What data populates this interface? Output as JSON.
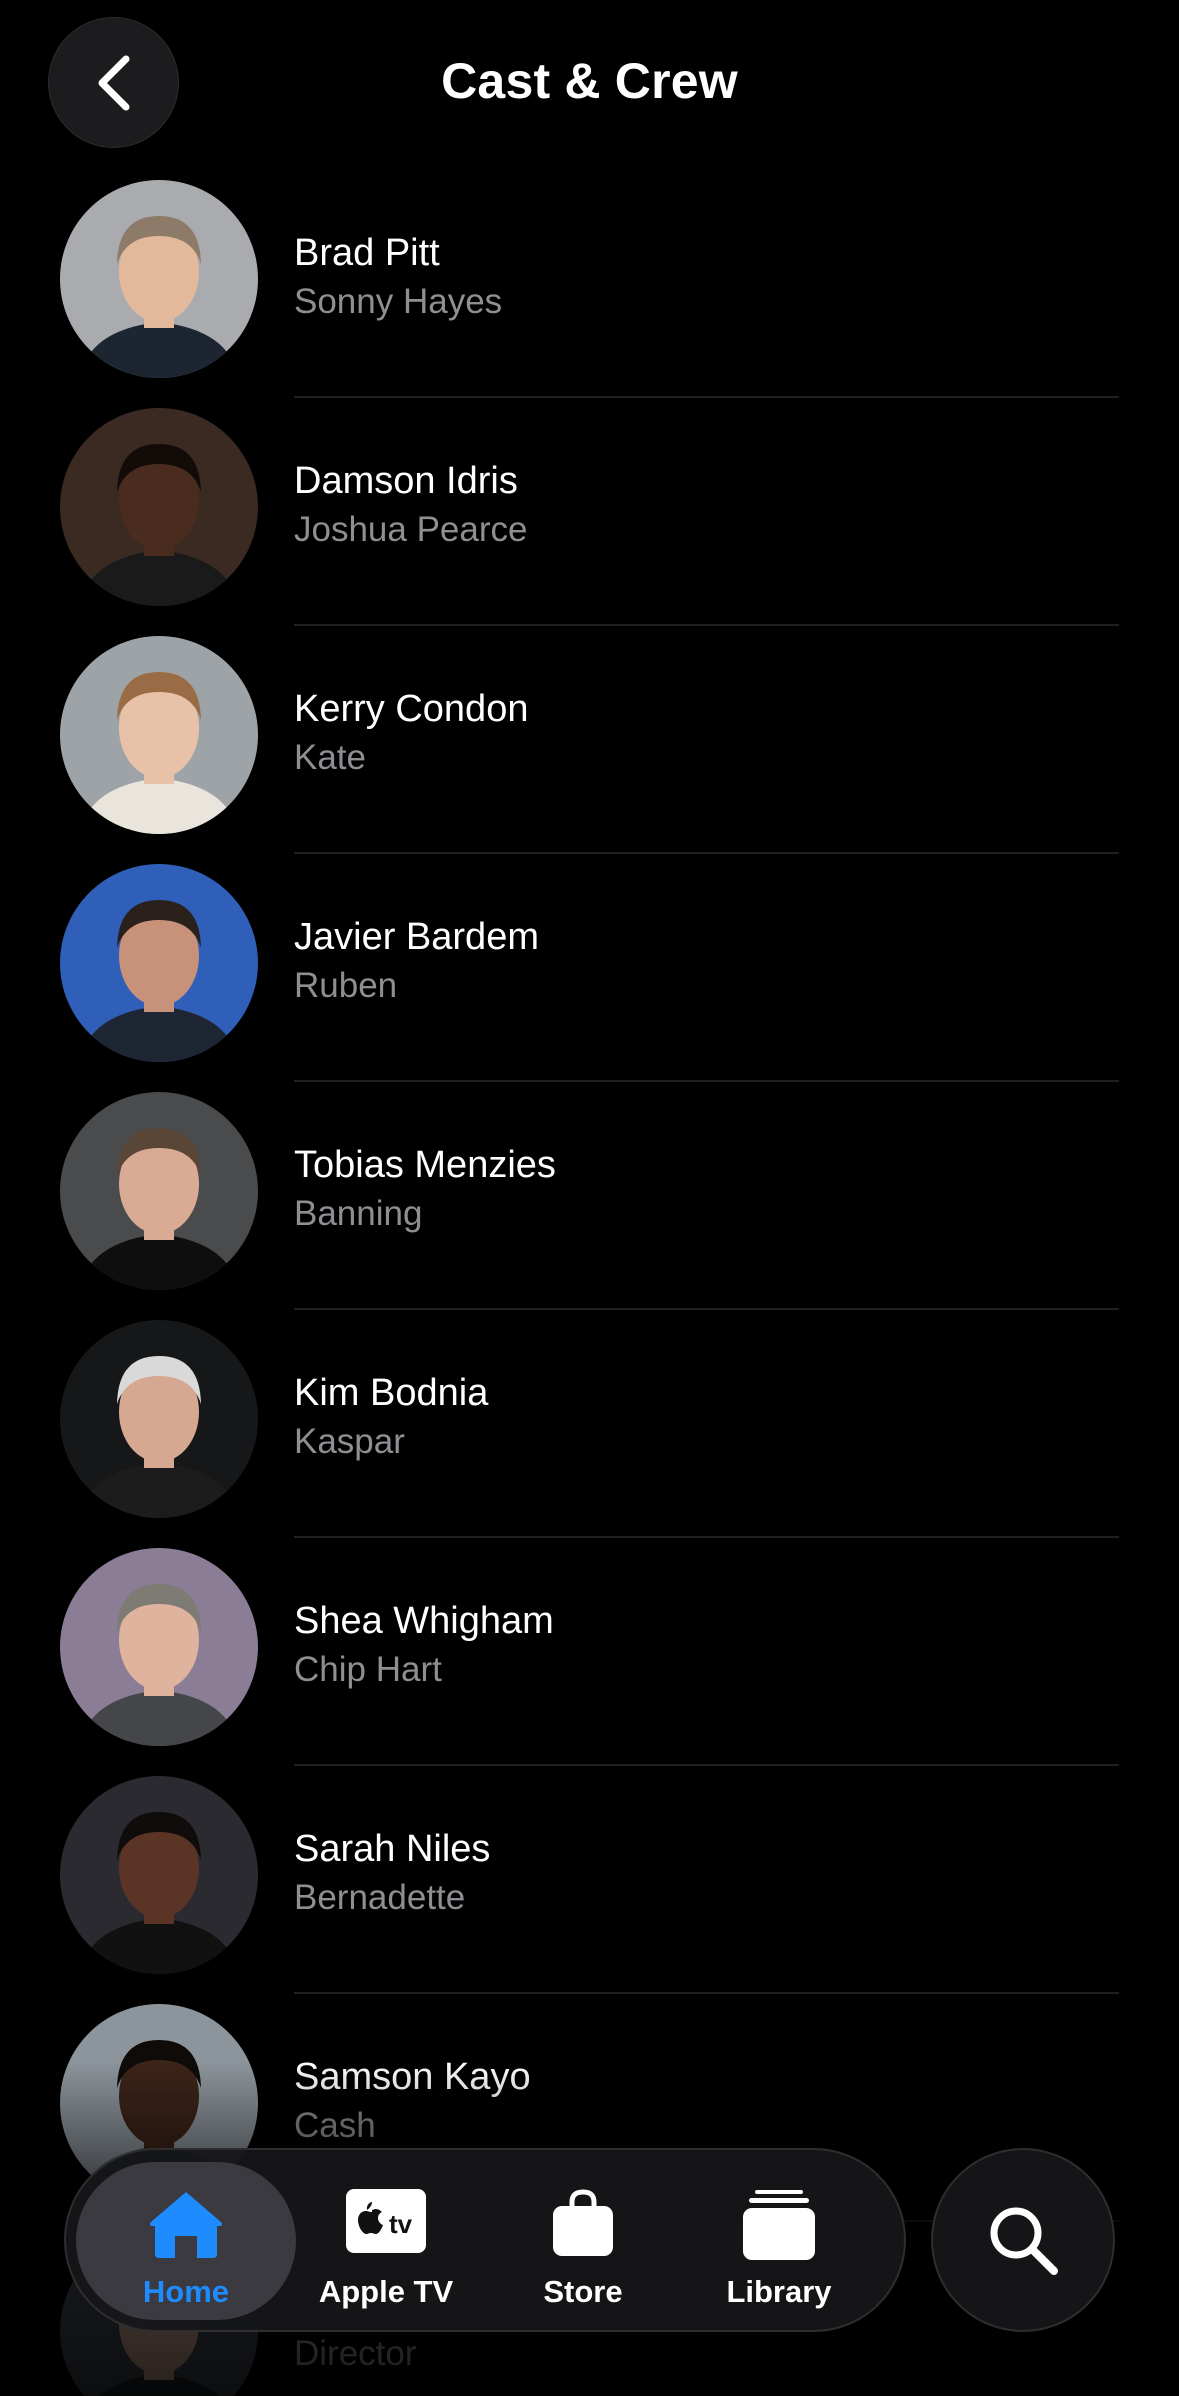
{
  "header": {
    "title": "Cast & Crew"
  },
  "cast": [
    {
      "name": "Brad Pitt",
      "role": "Sonny Hayes",
      "bg": "#a9abaf",
      "skin": "#e2b99b",
      "hair": "#8d7a68",
      "shirt": "#1d2530"
    },
    {
      "name": "Damson Idris",
      "role": "Joshua Pearce",
      "bg": "#3a2a22",
      "skin": "#4a2c1f",
      "hair": "#120b08",
      "shirt": "#1a1a1a"
    },
    {
      "name": "Kerry Condon",
      "role": "Kate",
      "bg": "#9ea3a8",
      "skin": "#e8c2a8",
      "hair": "#9a6c45",
      "shirt": "#e9e4dc"
    },
    {
      "name": "Javier Bardem",
      "role": "Ruben",
      "bg": "#2f5fb8",
      "skin": "#c8917a",
      "hair": "#2a211c",
      "shirt": "#1e2633"
    },
    {
      "name": "Tobias Menzies",
      "role": "Banning",
      "bg": "#4a4b4d",
      "skin": "#d9ab94",
      "hair": "#5a4636",
      "shirt": "#0e0e0e"
    },
    {
      "name": "Kim Bodnia",
      "role": "Kaspar",
      "bg": "#151719",
      "skin": "#d6a891",
      "hair": "#d9d9d9",
      "shirt": "#1c1c1c"
    },
    {
      "name": "Shea Whigham",
      "role": "Chip Hart",
      "bg": "#8b7d95",
      "skin": "#e0b39e",
      "hair": "#7e7a74",
      "shirt": "#45464a"
    },
    {
      "name": "Sarah Niles",
      "role": "Bernadette",
      "bg": "#2a2a30",
      "skin": "#5a3526",
      "hair": "#0f0c0b",
      "shirt": "#111111"
    },
    {
      "name": "Samson Kayo",
      "role": "Cash",
      "bg": "#8d959c",
      "skin": "#3d2419",
      "hair": "#0e0b09",
      "shirt": "#202632"
    },
    {
      "name": "",
      "role": "Director",
      "bg": "#3e4650",
      "skin": "#c9a08c",
      "hair": "#2b2b2b",
      "shirt": "#22252a"
    }
  ],
  "tabs": [
    {
      "label": "Home",
      "icon": "house-icon",
      "active": true
    },
    {
      "label": "Apple TV",
      "icon": "apple-tv-icon",
      "active": false
    },
    {
      "label": "Store",
      "icon": "shopping-bag-icon",
      "active": false
    },
    {
      "label": "Library",
      "icon": "library-stack-icon",
      "active": false
    }
  ],
  "search": {
    "icon": "magnifying-glass-icon"
  },
  "colors": {
    "accent": "#1e8bff",
    "background": "#000000",
    "secondaryText": "#8e8e93"
  }
}
